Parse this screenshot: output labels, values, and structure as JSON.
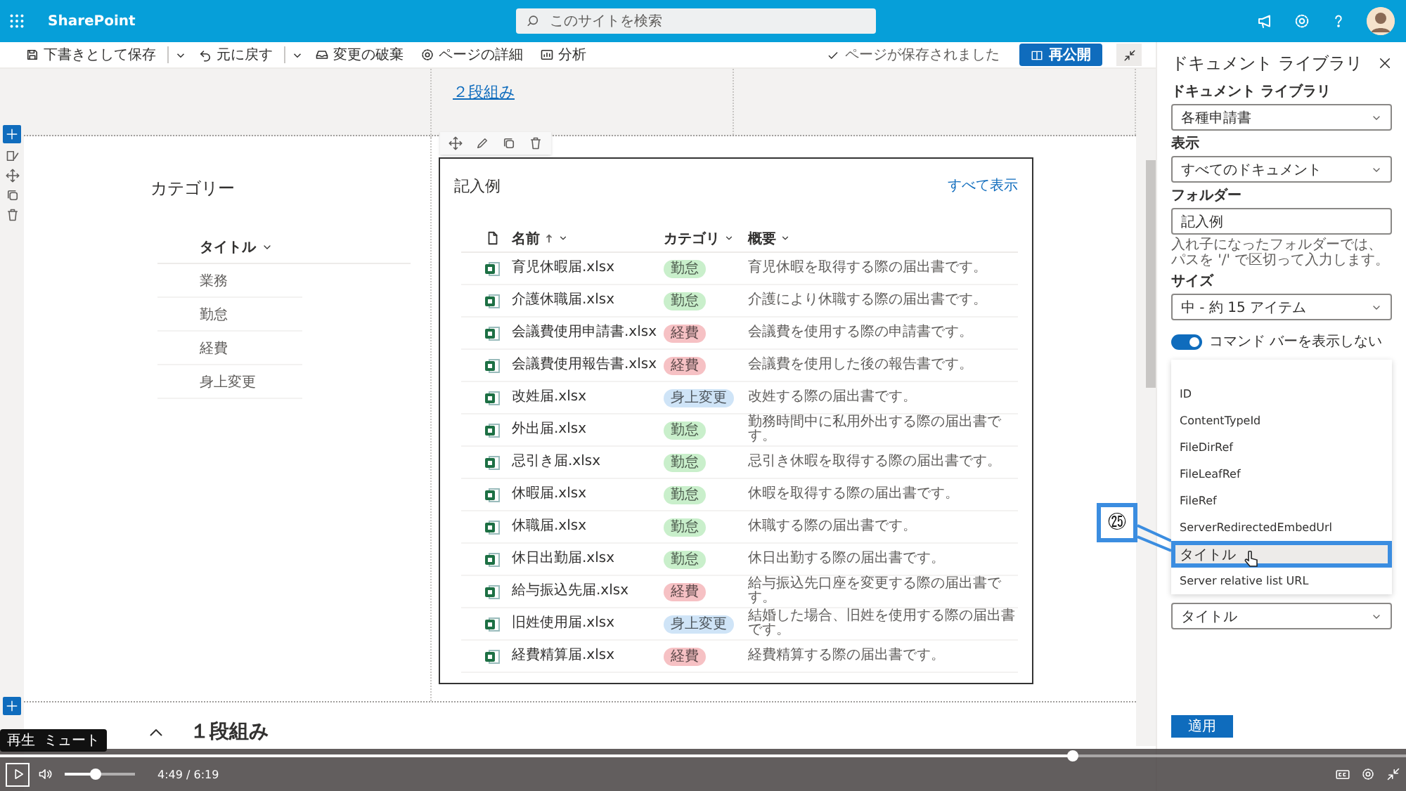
{
  "top_bar": {
    "app_name": "SharePoint",
    "search_placeholder": "このサイトを検索"
  },
  "command_bar": {
    "items": [
      {
        "label": "下書きとして保存",
        "kind": "save",
        "dropdown": true
      },
      {
        "label": "元に戻す",
        "kind": "undo",
        "dropdown": true
      },
      {
        "label": "変更の破棄",
        "kind": "discard",
        "dropdown": false
      },
      {
        "label": "ページの詳細",
        "kind": "details",
        "dropdown": false
      },
      {
        "label": "分析",
        "kind": "analytics",
        "dropdown": false
      }
    ],
    "status": "ページが保存されました",
    "publish_button": "再公開"
  },
  "top_section": {
    "link": "２段組み"
  },
  "category_list": {
    "title": "カテゴリー",
    "column": "タイトル",
    "rows": [
      "業務",
      "勤怠",
      "経費",
      "身上変更"
    ]
  },
  "library": {
    "title": "記入例",
    "see_all": "すべて表示",
    "columns": [
      {
        "label": "名前",
        "sorted": true
      },
      {
        "label": "カテゴリ",
        "sorted": false
      },
      {
        "label": "概要",
        "sorted": false
      }
    ],
    "rows": [
      {
        "name": "育児休暇届.xlsx",
        "category": "勤怠",
        "color": "#c9efcb",
        "summary": "育児休暇を取得する際の届出書です。"
      },
      {
        "name": "介護休職届.xlsx",
        "category": "勤怠",
        "color": "#c9efcb",
        "summary": "介護により休職する際の届出書です。"
      },
      {
        "name": "会議費使用申請書.xlsx",
        "category": "経費",
        "color": "#f6c1c4",
        "summary": "会議費を使用する際の申請書です。"
      },
      {
        "name": "会議費使用報告書.xlsx",
        "category": "経費",
        "color": "#f6c1c4",
        "summary": "会議費を使用した後の報告書です。"
      },
      {
        "name": "改姓届.xlsx",
        "category": "身上変更",
        "color": "#cfe4f7",
        "summary": "改姓する際の届出書です。"
      },
      {
        "name": "外出届.xlsx",
        "category": "勤怠",
        "color": "#c9efcb",
        "summary": "勤務時間中に私用外出する際の届出書です。"
      },
      {
        "name": "忌引き届.xlsx",
        "category": "勤怠",
        "color": "#c9efcb",
        "summary": "忌引き休暇を取得する際の届出書です。"
      },
      {
        "name": "休暇届.xlsx",
        "category": "勤怠",
        "color": "#c9efcb",
        "summary": "休暇を取得する際の届出書です。"
      },
      {
        "name": "休職届.xlsx",
        "category": "勤怠",
        "color": "#c9efcb",
        "summary": "休職する際の届出書です。"
      },
      {
        "name": "休日出勤届.xlsx",
        "category": "勤怠",
        "color": "#c9efcb",
        "summary": "休日出勤する際の届出書です。"
      },
      {
        "name": "給与振込先届.xlsx",
        "category": "経費",
        "color": "#f6c1c4",
        "summary": "給与振込先口座を変更する際の届出書です。"
      },
      {
        "name": "旧姓使用届.xlsx",
        "category": "身上変更",
        "color": "#cfe4f7",
        "summary": "結婚した場合、旧姓を使用する際の届出書です。"
      },
      {
        "name": "経費精算届.xlsx",
        "category": "経費",
        "color": "#f6c1c4",
        "summary": "経費精算する際の届出書です。"
      }
    ]
  },
  "bottom_section": {
    "title": "１段組み"
  },
  "panel": {
    "title": "ドキュメント ライブラリ",
    "fields": [
      {
        "kind": "dropdown",
        "label": "ドキュメント ライブラリ",
        "value": "各種申請書"
      },
      {
        "kind": "dropdown",
        "label": "表示",
        "value": "すべてのドキュメント"
      },
      {
        "kind": "text",
        "label": "フォルダー",
        "value": "記入例",
        "hint": "入れ子になったフォルダーでは、パスを '/' で区切って入力します。"
      },
      {
        "kind": "dropdown",
        "label": "サイズ",
        "value": "中 - 約 15 アイテム"
      },
      {
        "kind": "toggle",
        "label": "コマンド バーを表示しない",
        "on": true
      }
    ],
    "menu": {
      "options": [
        {
          "label": "ID",
          "selected": false
        },
        {
          "label": "ContentTypeId",
          "selected": false
        },
        {
          "label": "FileDirRef",
          "selected": false
        },
        {
          "label": "FileLeafRef",
          "selected": false
        },
        {
          "label": "FileRef",
          "selected": false
        },
        {
          "label": "ServerRedirectedEmbedUrl",
          "selected": false
        },
        {
          "label": "タイトル",
          "selected": true
        },
        {
          "label": "Server relative list URL",
          "selected": false
        }
      ]
    },
    "dropdown_value": "タイトル",
    "apply_button": "適用"
  },
  "callout": {
    "number": "㉕"
  },
  "player": {
    "tooltips": [
      "再生",
      "ミュート"
    ],
    "progress": {
      "level": 0.763
    },
    "volume": {
      "level": 0.43
    },
    "time": "4:49 / 6:19"
  }
}
